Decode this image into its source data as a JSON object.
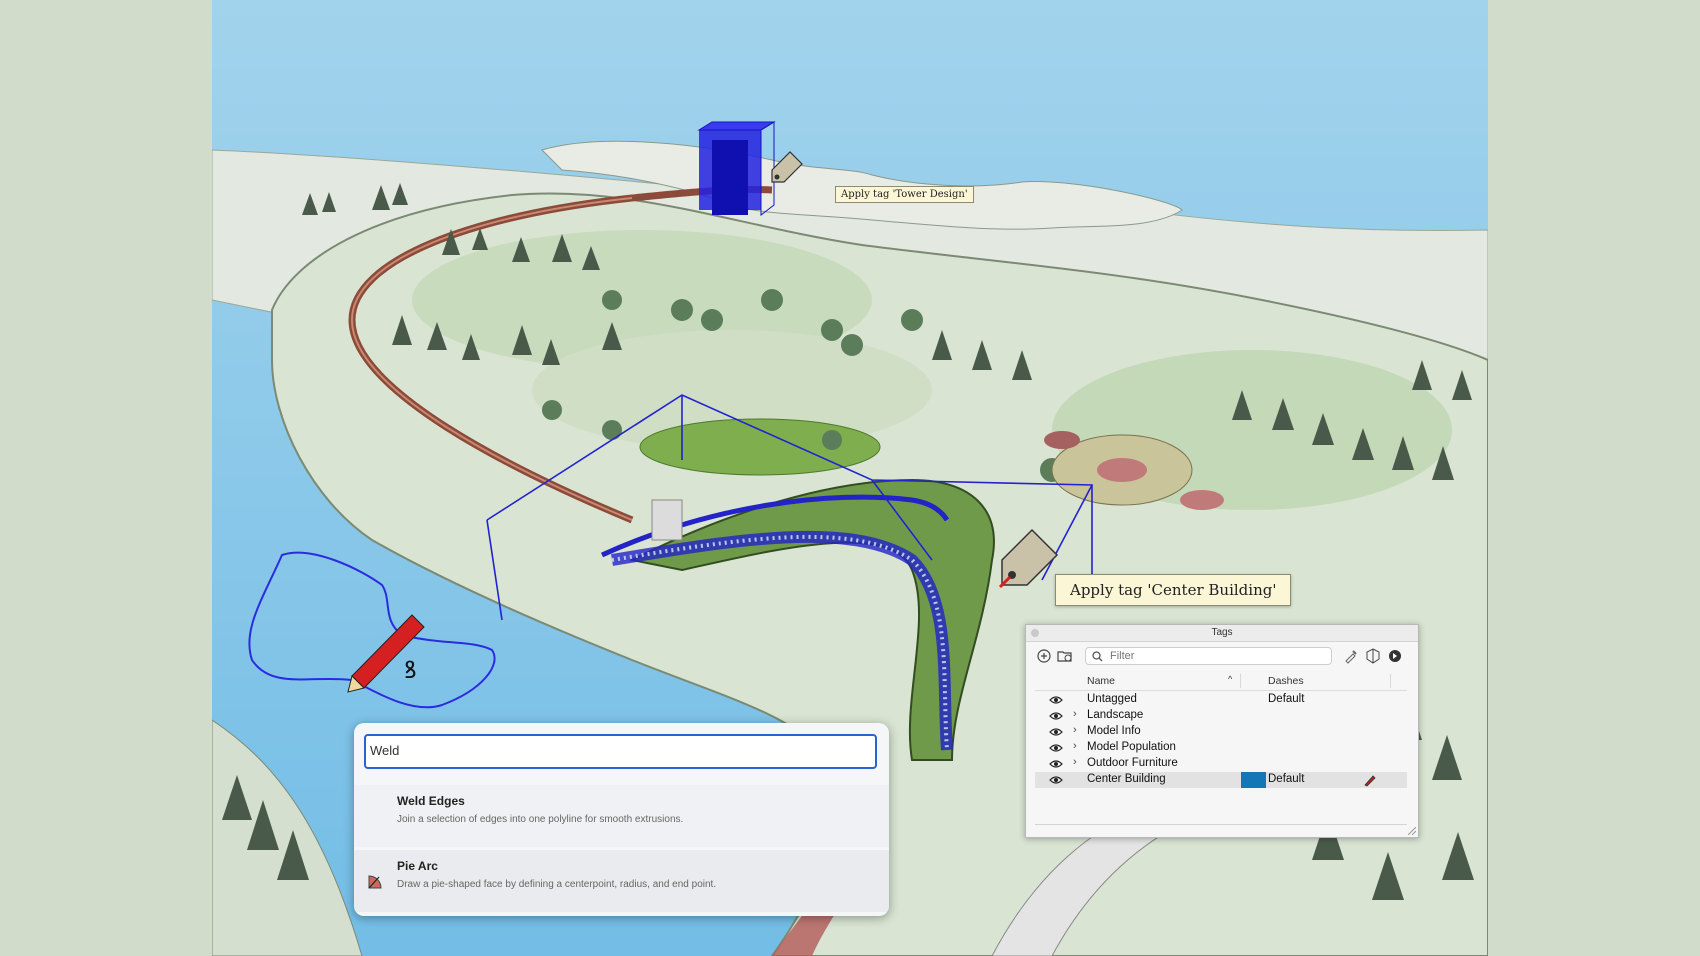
{
  "viewport": {
    "tooltips": {
      "tower": "Apply tag 'Tower Design'",
      "center": "Apply tag 'Center Building'"
    }
  },
  "search": {
    "value": "Weld",
    "results": [
      {
        "title": "Weld Edges",
        "description": "Join a selection of edges into one polyline for smooth extrusions.",
        "icon": "weld-icon"
      },
      {
        "title": "Pie Arc",
        "description": "Draw a pie-shaped face by defining a centerpoint, radius, and end point.",
        "icon": "pie-arc-icon"
      }
    ]
  },
  "tags_panel": {
    "title": "Tags",
    "filter_placeholder": "Filter",
    "columns": {
      "name": "Name",
      "dashes": "Dashes"
    },
    "rows": [
      {
        "name": "Untagged",
        "dashes": "Default",
        "expandable": false
      },
      {
        "name": "Landscape",
        "dashes": "",
        "expandable": true
      },
      {
        "name": "Model Info",
        "dashes": "",
        "expandable": true
      },
      {
        "name": "Model Population",
        "dashes": "",
        "expandable": true
      },
      {
        "name": "Outdoor Furniture",
        "dashes": "",
        "expandable": true
      },
      {
        "name": "Center Building",
        "dashes": "Default",
        "expandable": false,
        "selected": true,
        "color": "#1477b5"
      }
    ]
  },
  "colors": {
    "water": "#7cc2e8",
    "land": "#dfe7da",
    "grass": "#c4dcb9",
    "selection": "#2020d0",
    "accent": "#2563d6"
  }
}
